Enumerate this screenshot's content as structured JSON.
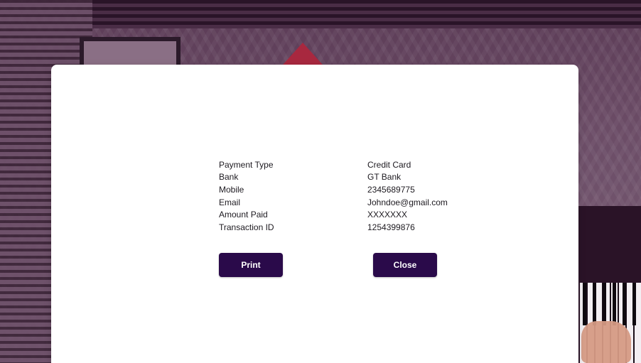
{
  "payment_details": {
    "rows": [
      {
        "label": "Payment Type",
        "value": "Credit Card"
      },
      {
        "label": "Bank",
        "value": "GT Bank"
      },
      {
        "label": "Mobile",
        "value": "2345689775"
      },
      {
        "label": "Email",
        "value": "Johndoe@gmail.com"
      },
      {
        "label": "Amount Paid",
        "value": "XXXXXXX"
      },
      {
        "label": "Transaction ID",
        "value": "1254399876"
      }
    ]
  },
  "actions": {
    "print_label": "Print",
    "close_label": "Close"
  },
  "colors": {
    "button_bg": "#2a0a4a",
    "modal_bg": "#ffffff"
  }
}
